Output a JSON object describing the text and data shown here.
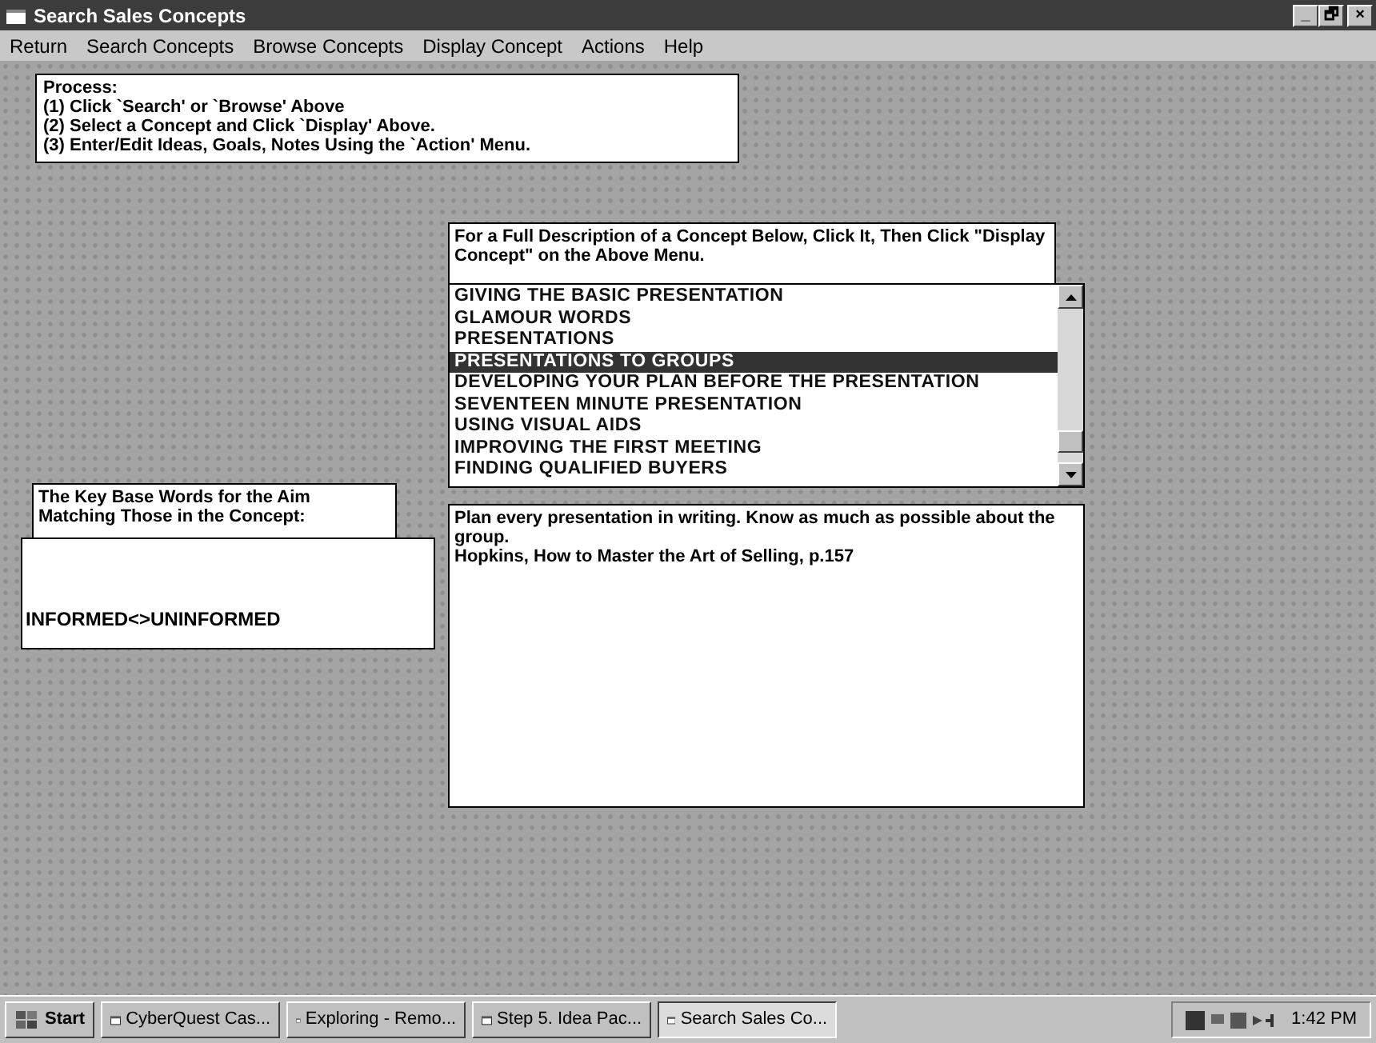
{
  "window": {
    "title": "Search Sales Concepts",
    "controls": [
      "_",
      "🗗",
      "×"
    ]
  },
  "menu": [
    "Return",
    "Search Concepts",
    "Browse Concepts",
    "Display Concept",
    "Actions",
    "Help"
  ],
  "process_lines": [
    "Process:",
    "(1) Click `Search' or `Browse' Above",
    "(2) Select a Concept and Click `Display' Above.",
    "(3) Enter/Edit Ideas, Goals, Notes Using the `Action' Menu."
  ],
  "instruction": "For a Full Description of a Concept Below, Click It,  Then Click \"Display Concept\" on the Above Menu.",
  "concepts": [
    {
      "label": "GIVING THE BASIC PRESENTATION",
      "selected": false
    },
    {
      "label": "GLAMOUR WORDS",
      "selected": false
    },
    {
      "label": "PRESENTATIONS",
      "selected": false
    },
    {
      "label": "PRESENTATIONS TO GROUPS",
      "selected": true
    },
    {
      "label": "DEVELOPING YOUR PLAN BEFORE THE PRESENTATION",
      "selected": false
    },
    {
      "label": "SEVENTEEN MINUTE PRESENTATION",
      "selected": false
    },
    {
      "label": "USING VISUAL AIDS",
      "selected": false
    },
    {
      "label": "IMPROVING THE FIRST MEETING",
      "selected": false
    },
    {
      "label": "FINDING QUALIFIED BUYERS",
      "selected": false
    }
  ],
  "key_words_label": "The Key Base Words for the Aim Matching Those in the Concept:",
  "key_words": "INFORMED<>UNINFORMED",
  "description_lines": [
    "Plan every presentation in writing. Know as much as possible about the group.",
    "Hopkins, How to Master the Art of Selling, p.157"
  ],
  "taskbar": {
    "start": "Start",
    "tasks": [
      {
        "label": "CyberQuest Cas...",
        "selected": false
      },
      {
        "label": "Exploring - Remo...",
        "selected": false
      },
      {
        "label": "Step 5. Idea Pac...",
        "selected": false
      },
      {
        "label": "Search Sales Co...",
        "selected": true
      }
    ],
    "clock": "1:42 PM"
  }
}
